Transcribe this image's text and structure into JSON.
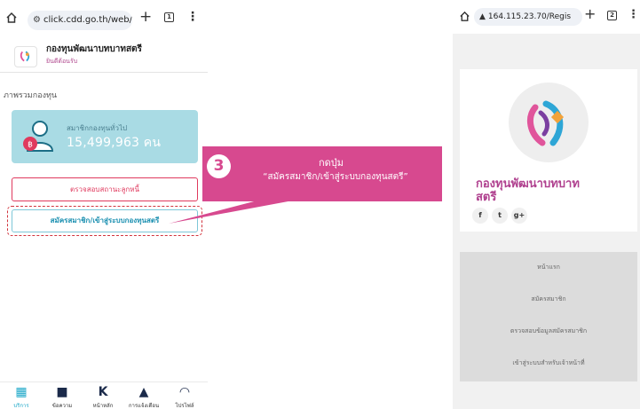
{
  "left_phone": {
    "url": "click.cdd.go.th/web/",
    "tab_count": "1",
    "site_title": "กองทุนพัฒนาบทบาทสตรี",
    "site_subtitle": "ยินดีต้อนรับ",
    "section_label": "ภาพรวมกองทุน",
    "stats_caption": "สมาชิกกองทุนทั่วไป",
    "stats_value": "15,499,963 คน",
    "check_status_button": "ตรวจสอบสถานะลูกหนี้",
    "register_button": "สมัครสมาชิก/เข้าสู่ระบบกองทุนสตรี",
    "nav": [
      {
        "icon": "grid-icon",
        "label": "บริการ"
      },
      {
        "icon": "chat-icon",
        "label": "ข้อความ"
      },
      {
        "icon": "k-logo-icon",
        "label": "หน้าหลัก"
      },
      {
        "icon": "bell-icon",
        "label": "การแจ้งเตือน"
      },
      {
        "icon": "profile-icon",
        "label": "โปรไฟล์"
      }
    ]
  },
  "callout": {
    "step": "3",
    "line1": "กดปุ่ม",
    "line2": "“สมัครสมาชิก/เข้าสู่ระบบกองทุนสตรี”"
  },
  "right_phone": {
    "url": "164.115.23.70/Regis",
    "tab_count": "2",
    "brand_line1": "กองทุนพัฒนาบทบาท",
    "brand_line2": "สตรี",
    "social": [
      "f",
      "t",
      "g+"
    ],
    "menu": [
      "หน้าแรก",
      "สมัครสมาชิก",
      "ตรวจสอบข้อมูลสมัครสมาชิก",
      "เข้าสู่ระบบสำหรับเจ้าหน้าที่"
    ]
  },
  "colors": {
    "accent_pink": "#d7498f",
    "stats_card": "#a9dbe4",
    "brand_magenta": "#b0418f",
    "button_red": "#e03a5e",
    "button_blue": "#1a8fb0"
  }
}
